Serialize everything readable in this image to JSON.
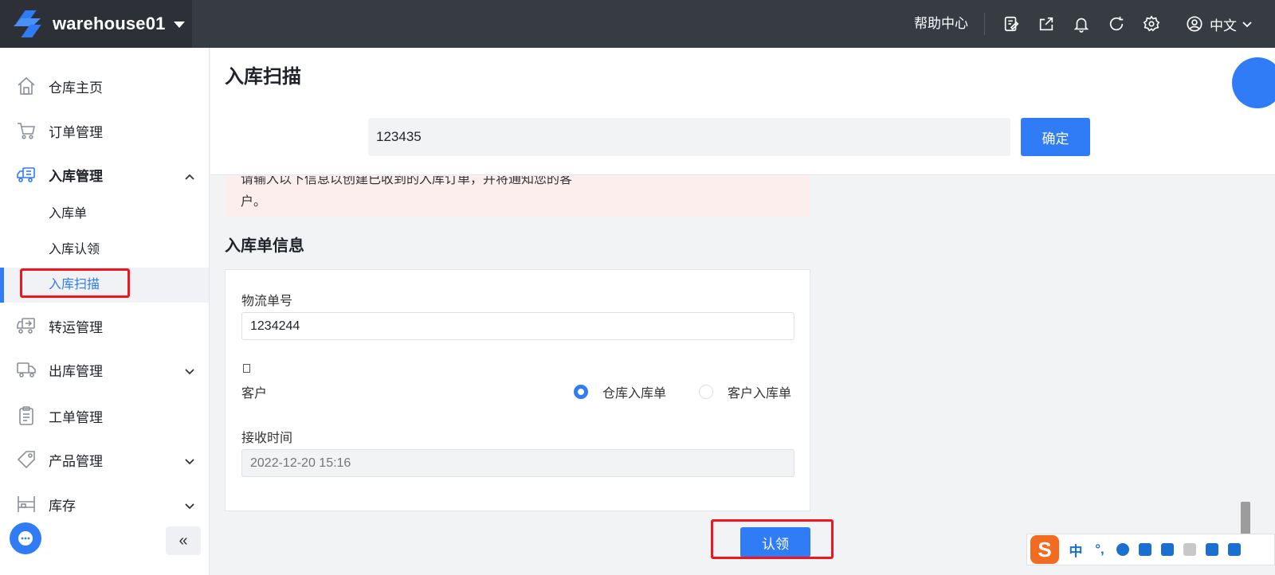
{
  "topbar": {
    "warehouse_name": "warehouse01",
    "help_label": "帮助中心",
    "language_label": "中文",
    "icons": [
      "edit-note-icon",
      "share-icon",
      "bell-icon",
      "refresh-icon",
      "gear-icon",
      "user-icon"
    ]
  },
  "sidebar": {
    "items": [
      {
        "label": "仓库主页",
        "icon": "home-icon"
      },
      {
        "label": "订单管理",
        "icon": "cart-icon"
      },
      {
        "label": "入库管理",
        "icon": "truck-inbound-icon",
        "expanded": true
      },
      {
        "label": "转运管理",
        "icon": "transfer-icon"
      },
      {
        "label": "出库管理",
        "icon": "truck-outbound-icon"
      },
      {
        "label": "工单管理",
        "icon": "clipboard-icon"
      },
      {
        "label": "产品管理",
        "icon": "tag-icon"
      },
      {
        "label": "库存",
        "icon": "shelf-icon"
      }
    ],
    "subitems": [
      {
        "label": "入库单"
      },
      {
        "label": "入库认领"
      },
      {
        "label": "入库扫描",
        "active": true
      }
    ],
    "collapse_label": "«"
  },
  "main": {
    "page_title": "入库扫描",
    "scan_input_value": "123435",
    "confirm_label": "确定",
    "alert_line1": "请输入以下信息以创建已收到的入库订单，并将通知您的客",
    "alert_line2": "户。",
    "section_title": "入库单信息",
    "form": {
      "tracking_label": "物流单号",
      "tracking_value": "1234244",
      "customer_label": "客户",
      "radio_options": [
        {
          "label": "仓库入库单",
          "checked": true
        },
        {
          "label": "客户入库单",
          "checked": false
        }
      ],
      "receive_time_label": "接收时间",
      "receive_time_placeholder": "2022-12-20 15:16"
    },
    "claim_label": "认领"
  },
  "ime": {
    "logo": "S",
    "mode": "中",
    "punct": "°,"
  },
  "colors": {
    "accent": "#2f7cf6",
    "topbar": "#373c43",
    "highlight_box": "#f0161b",
    "alert_bg": "#fdeeee"
  }
}
